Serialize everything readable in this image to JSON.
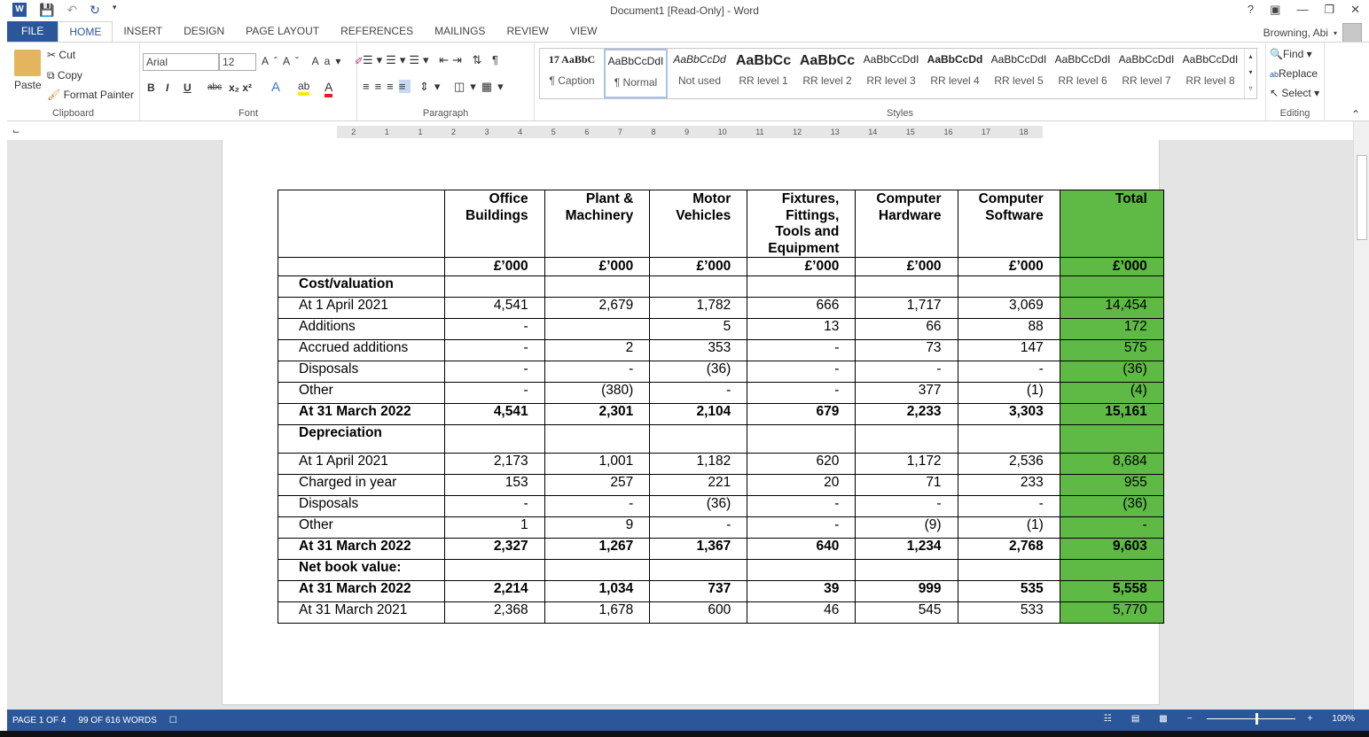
{
  "window": {
    "title": "Document1 [Read-Only] - Word",
    "help": "?",
    "user": "Browning, Abi"
  },
  "tabs": [
    "FILE",
    "HOME",
    "INSERT",
    "DESIGN",
    "PAGE LAYOUT",
    "REFERENCES",
    "MAILINGS",
    "REVIEW",
    "VIEW"
  ],
  "clipboard": {
    "paste": "Paste",
    "cut": "Cut",
    "copy": "Copy",
    "format_painter": "Format Painter",
    "label": "Clipboard"
  },
  "font": {
    "name": "Arial",
    "size": "12",
    "label": "Font",
    "bold": "B",
    "italic": "I",
    "underline": "U",
    "strike": "abc"
  },
  "paragraph": {
    "label": "Paragraph"
  },
  "styles": {
    "label": "Styles",
    "items": [
      {
        "preview": "17 AaBbC",
        "name": "¶ Caption"
      },
      {
        "preview": "AaBbCcDdI",
        "name": "¶ Normal"
      },
      {
        "preview": "AaBbCcDd",
        "name": "Not used"
      },
      {
        "preview": "AaBbCc",
        "name": "RR level 1"
      },
      {
        "preview": "AaBbCc",
        "name": "RR level 2"
      },
      {
        "preview": "AaBbCcDdI",
        "name": "RR level 3"
      },
      {
        "preview": "AaBbCcDd",
        "name": "RR level 4"
      },
      {
        "preview": "AaBbCcDdI",
        "name": "RR level 5"
      },
      {
        "preview": "AaBbCcDdI",
        "name": "RR level 6"
      },
      {
        "preview": "AaBbCcDdI",
        "name": "RR level 7"
      },
      {
        "preview": "AaBbCcDdI",
        "name": "RR level 8"
      }
    ]
  },
  "editing": {
    "find": "Find",
    "replace": "Replace",
    "select": "Select",
    "label": "Editing"
  },
  "ruler": [
    "2",
    "1",
    "1",
    "2",
    "3",
    "4",
    "5",
    "6",
    "7",
    "8",
    "9",
    "10",
    "11",
    "12",
    "13",
    "14",
    "15",
    "16",
    "17",
    "18"
  ],
  "table": {
    "headers": [
      "",
      "Office Buildings",
      "Plant & Machinery",
      "Motor Vehicles",
      "Fixtures, Fittings, Tools and Equipment",
      "Computer Hardware",
      "Computer Software",
      "Total"
    ],
    "units": [
      "",
      "£’000",
      "£’000",
      "£’000",
      "£’000",
      "£’000",
      "£’000",
      "£’000"
    ],
    "rows": [
      {
        "cells": [
          "Cost/valuation",
          "",
          "",
          "",
          "",
          "",
          "",
          ""
        ],
        "bold": true
      },
      {
        "cells": [
          "At 1 April 2021",
          "4,541",
          "2,679",
          "1,782",
          "666",
          "1,717",
          "3,069",
          "14,454"
        ]
      },
      {
        "cells": [
          "Additions",
          "-",
          "",
          "5",
          "13",
          "66",
          "88",
          "172"
        ]
      },
      {
        "cells": [
          "Accrued additions",
          "-",
          "2",
          "353",
          "-",
          "73",
          "147",
          "575"
        ]
      },
      {
        "cells": [
          "Disposals",
          "-",
          "-",
          "(36)",
          "-",
          "-",
          "-",
          "(36)"
        ]
      },
      {
        "cells": [
          "Other",
          "-",
          "(380)",
          "-",
          "-",
          "377",
          "(1)",
          "(4)"
        ]
      },
      {
        "cells": [
          "At 31 March 2022",
          "4,541",
          "2,301",
          "2,104",
          "679",
          "2,233",
          "3,303",
          "15,161"
        ],
        "bold": true
      },
      {
        "cells": [
          "Depreciation",
          "",
          "",
          "",
          "",
          "",
          "",
          ""
        ],
        "bold": true,
        "tall": true
      },
      {
        "cells": [
          "At 1 April 2021",
          "2,173",
          "1,001",
          "1,182",
          "620",
          "1,172",
          "2,536",
          "8,684"
        ]
      },
      {
        "cells": [
          "Charged in year",
          "153",
          "257",
          "221",
          "20",
          "71",
          "233",
          "955"
        ]
      },
      {
        "cells": [
          "Disposals",
          "-",
          "-",
          "(36)",
          "-",
          "-",
          "-",
          "(36)"
        ]
      },
      {
        "cells": [
          "Other",
          "1",
          "9",
          "-",
          "-",
          "(9)",
          "(1)",
          "-"
        ]
      },
      {
        "cells": [
          "At 31 March 2022",
          "2,327",
          "1,267",
          "1,367",
          "640",
          "1,234",
          "2,768",
          "9,603"
        ],
        "bold": true
      },
      {
        "cells": [
          "Net book value:",
          "",
          "",
          "",
          "",
          "",
          "",
          ""
        ],
        "bold": true
      },
      {
        "cells": [
          "At 31 March 2022",
          "2,214",
          "1,034",
          "737",
          "39",
          "999",
          "535",
          "5,558"
        ],
        "bold": true
      },
      {
        "cells": [
          "At 31 March 2021",
          "2,368",
          "1,678",
          "600",
          "46",
          "545",
          "533",
          "5,770"
        ]
      }
    ]
  },
  "status": {
    "page": "PAGE 1 OF 4",
    "words": "99 OF 616 WORDS",
    "zoom": "100%"
  },
  "colors": {
    "accent": "#2b579a",
    "total_column": "#5fba45"
  }
}
